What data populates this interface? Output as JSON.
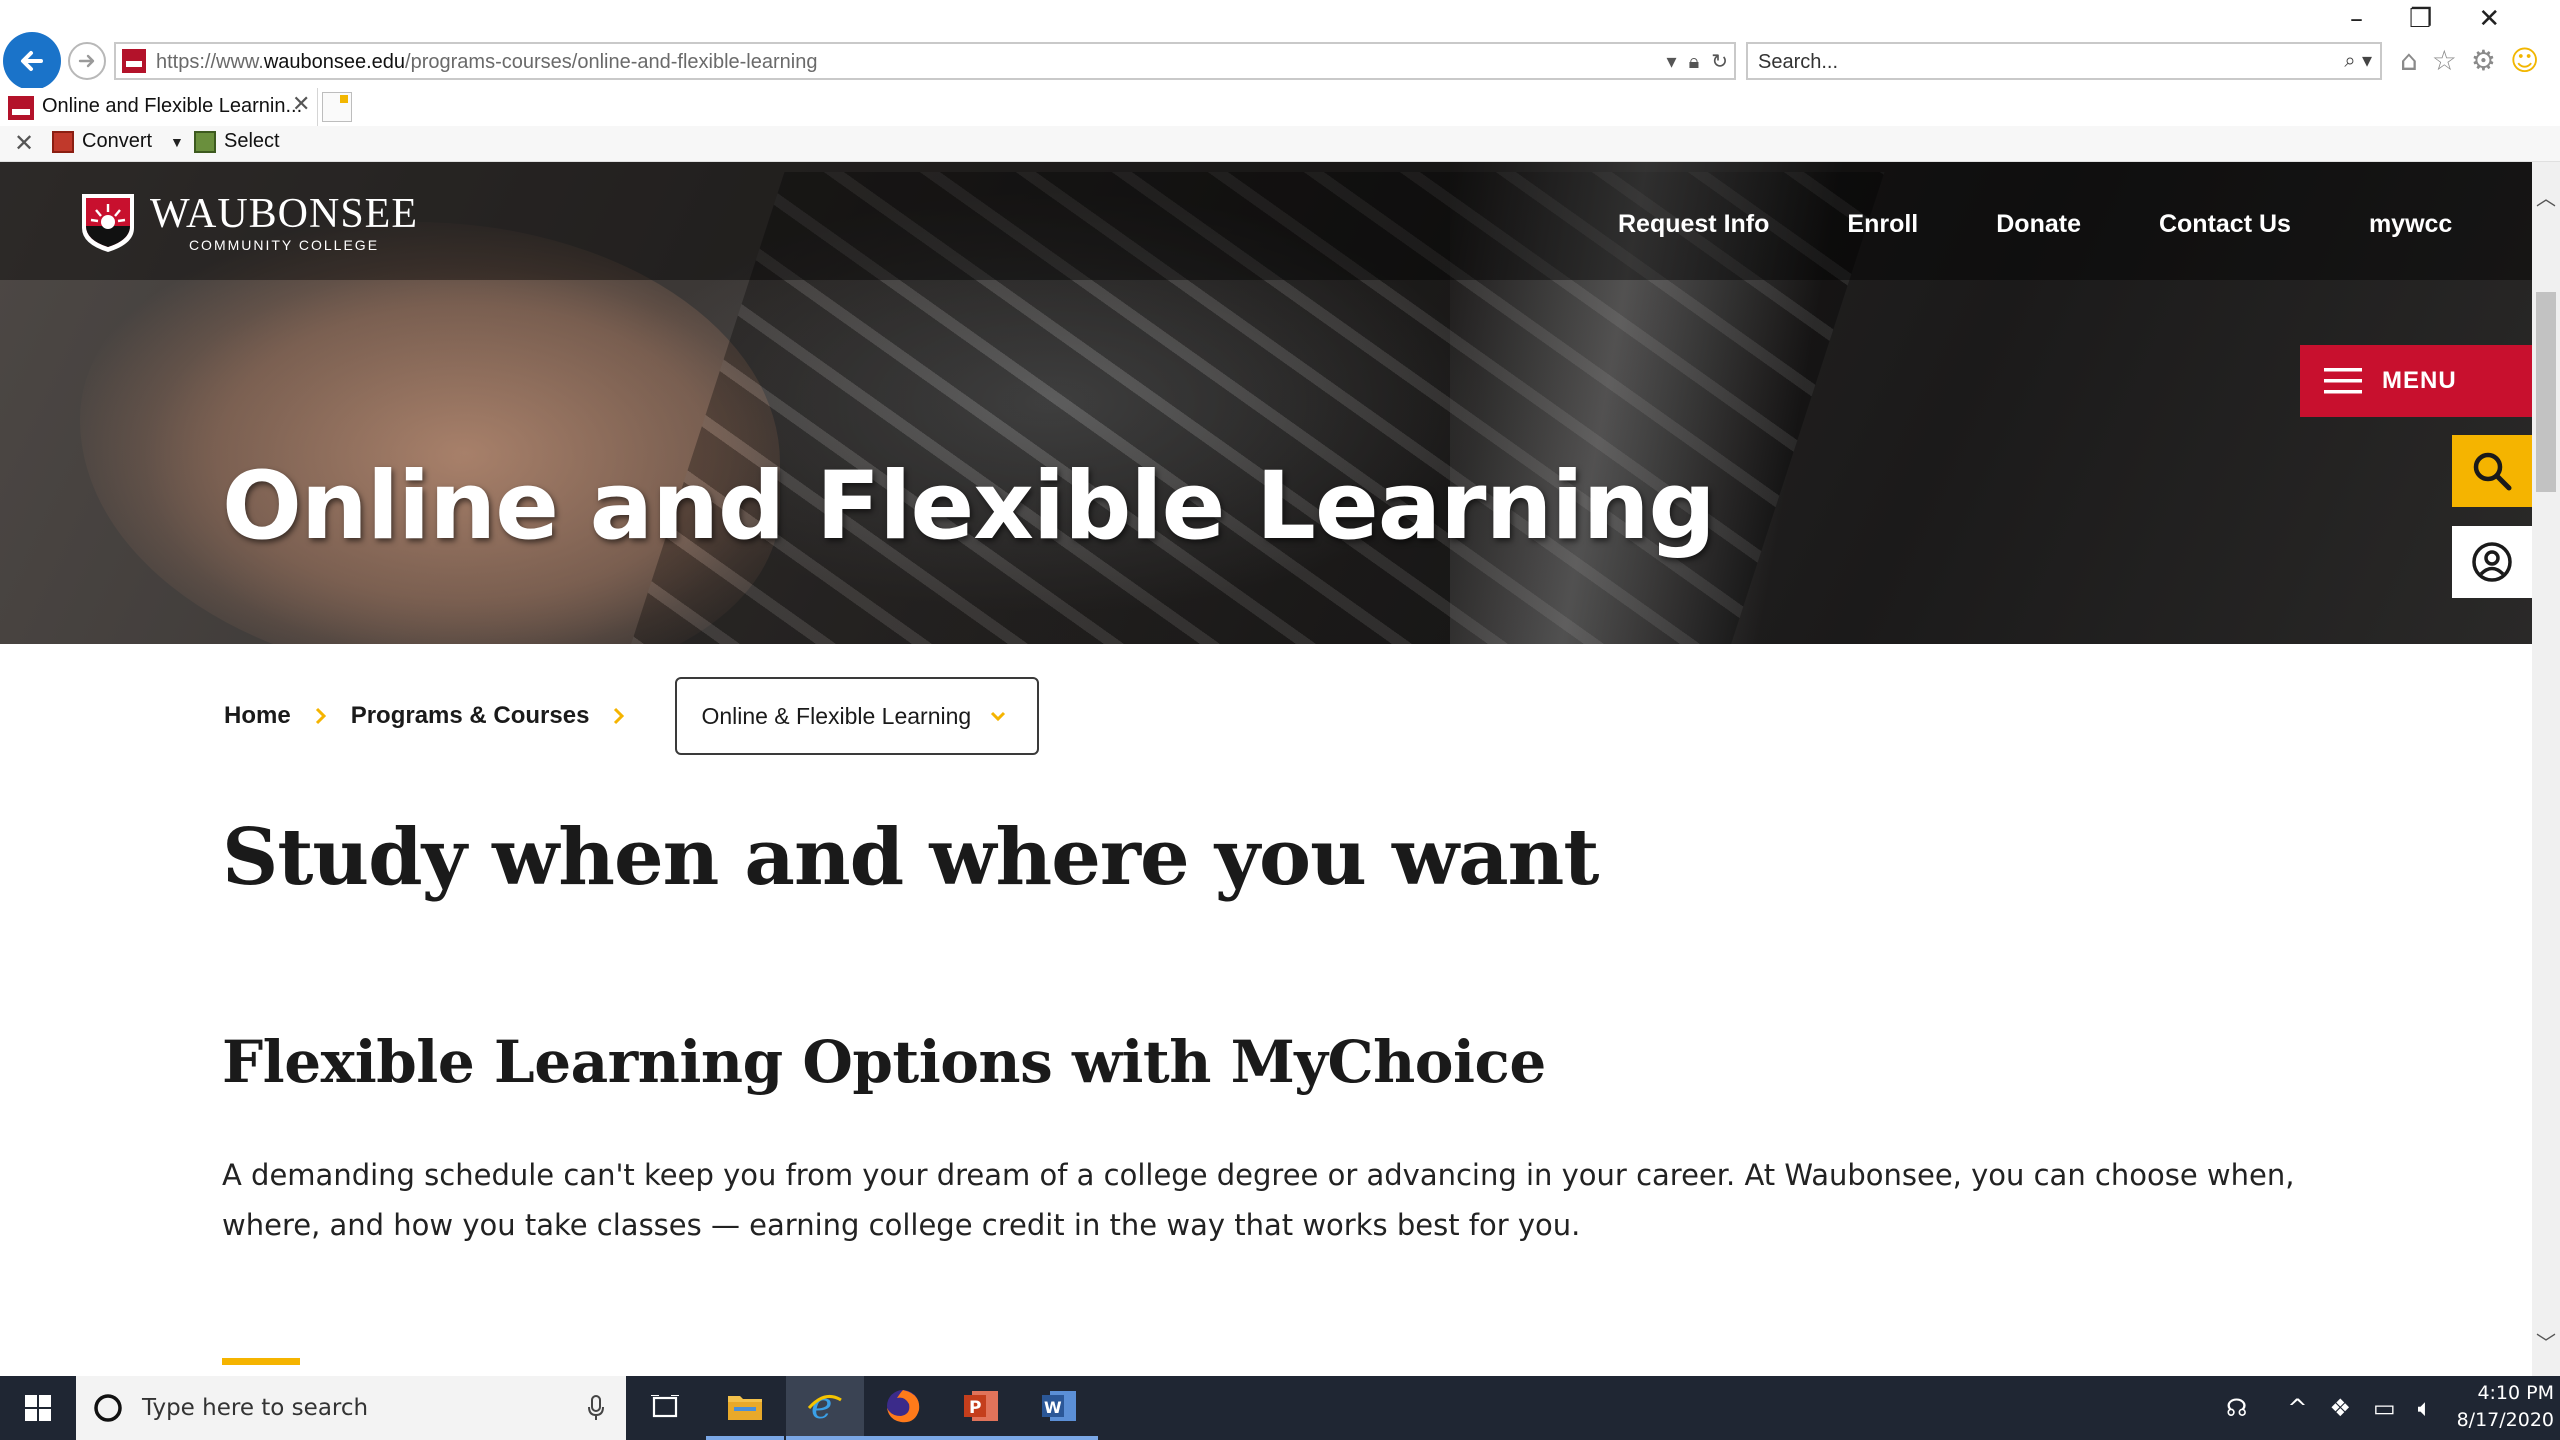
{
  "browser": {
    "url_prefix": "https://www.",
    "url_domain": "waubonsee.edu",
    "url_path": "/programs-courses/online-and-flexible-learning",
    "search_placeholder": "Search...",
    "tab_title": "Online and Flexible Learnin...",
    "command_bar": {
      "convert_label": "Convert",
      "select_label": "Select"
    }
  },
  "site": {
    "logo_name": "WAUBONSEE",
    "logo_subtitle": "COMMUNITY COLLEGE",
    "top_nav": [
      "Request Info",
      "Enroll",
      "Donate",
      "Contact Us",
      "mywcc"
    ],
    "menu_label": "MENU",
    "hero_title": "Online and Flexible Learning",
    "brand_colors": {
      "red": "#c8102e",
      "gold": "#f5b400"
    }
  },
  "breadcrumb": {
    "items": [
      "Home",
      "Programs & Courses"
    ],
    "current": "Online & Flexible Learning"
  },
  "main": {
    "heading": "Study when and where you want",
    "section_heading": "Flexible Learning Options with MyChoice",
    "intro": "A demanding schedule can't keep you from your dream of a college degree or advancing in your career. At Waubonsee, you can choose when, where, and how you take classes — earning college credit in the way that works best for you."
  },
  "taskbar": {
    "search_placeholder": "Type here to search",
    "apps": [
      "task-view",
      "file-explorer",
      "internet-explorer",
      "firefox",
      "powerpoint",
      "word"
    ],
    "time": "4:10 PM",
    "date": "8/17/2020"
  }
}
